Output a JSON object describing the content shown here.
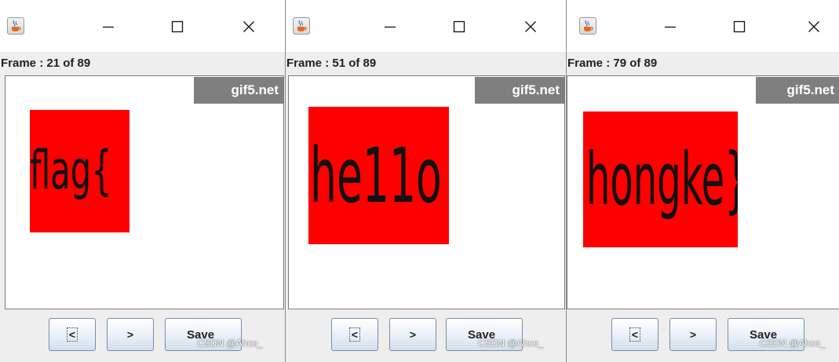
{
  "windows": [
    {
      "frame_label": "Frame : 21 of 89",
      "watermark": "gif5.net",
      "image_text": "flag{",
      "buttons": {
        "prev": "<",
        "next": ">",
        "save": "Save"
      },
      "overlay": "CSDN @Ahco_"
    },
    {
      "frame_label": "Frame : 51 of 89",
      "watermark": "gif5.net",
      "image_text": "he11o",
      "buttons": {
        "prev": "<",
        "next": ">",
        "save": "Save"
      },
      "overlay": "CSDN @Ahco_"
    },
    {
      "frame_label": "Frame : 79 of 89",
      "watermark": "gif5.net",
      "image_text": "hongke}",
      "buttons": {
        "prev": "<",
        "next": ">",
        "save": "Save"
      },
      "overlay": "CSDN @Ahco_"
    }
  ],
  "colors": {
    "frame_fill": "#ff0000",
    "watermark_bg": "#7f7f7f",
    "button_border": "#7a8ea8"
  },
  "icons": {
    "app": "java-coffee-cup-icon",
    "minimize": "minimize-icon",
    "maximize": "maximize-icon",
    "close": "close-icon"
  }
}
